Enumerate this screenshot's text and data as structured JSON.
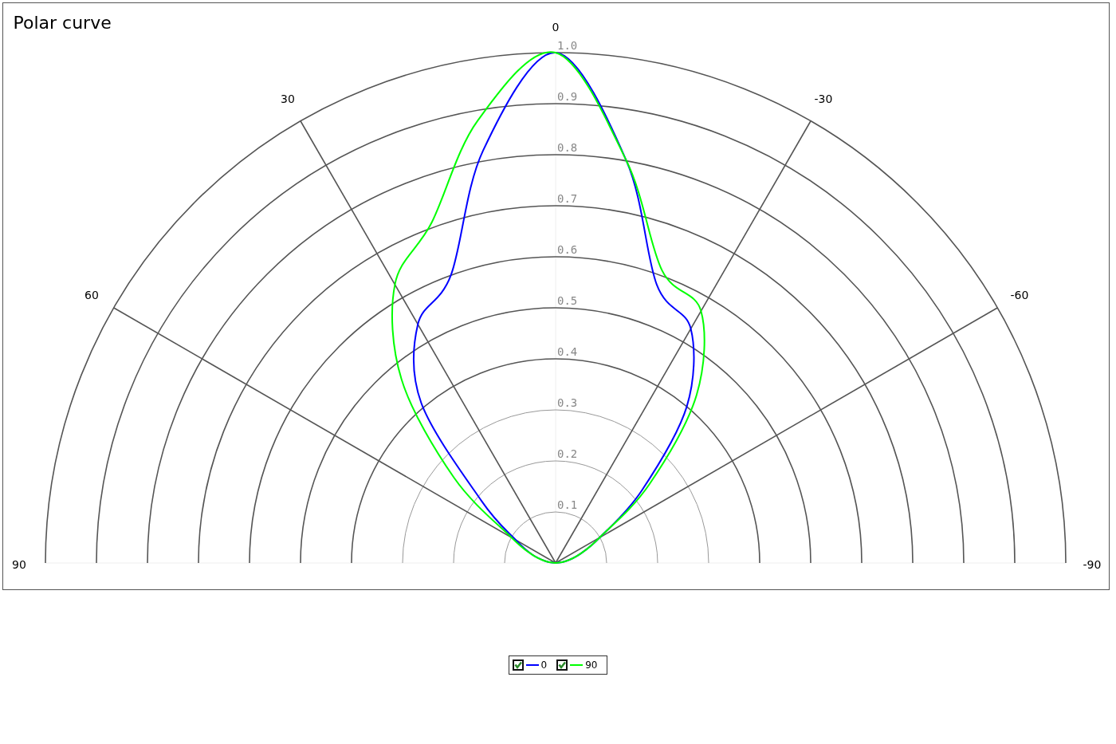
{
  "chart": {
    "title": "Polar curve",
    "angle_labels": [
      "90",
      "60",
      "30",
      "0",
      "-30",
      "-60",
      "-90"
    ],
    "radius_labels": [
      "1.0",
      "0.9",
      "0.8",
      "0.7",
      "0.6",
      "0.5",
      "0.4",
      "0.3",
      "0.2",
      "0.1"
    ]
  },
  "legend": [
    {
      "label": "0",
      "checked": true,
      "color": "#0000ff"
    },
    {
      "label": "90",
      "checked": true,
      "color": "#00ff00"
    }
  ]
}
